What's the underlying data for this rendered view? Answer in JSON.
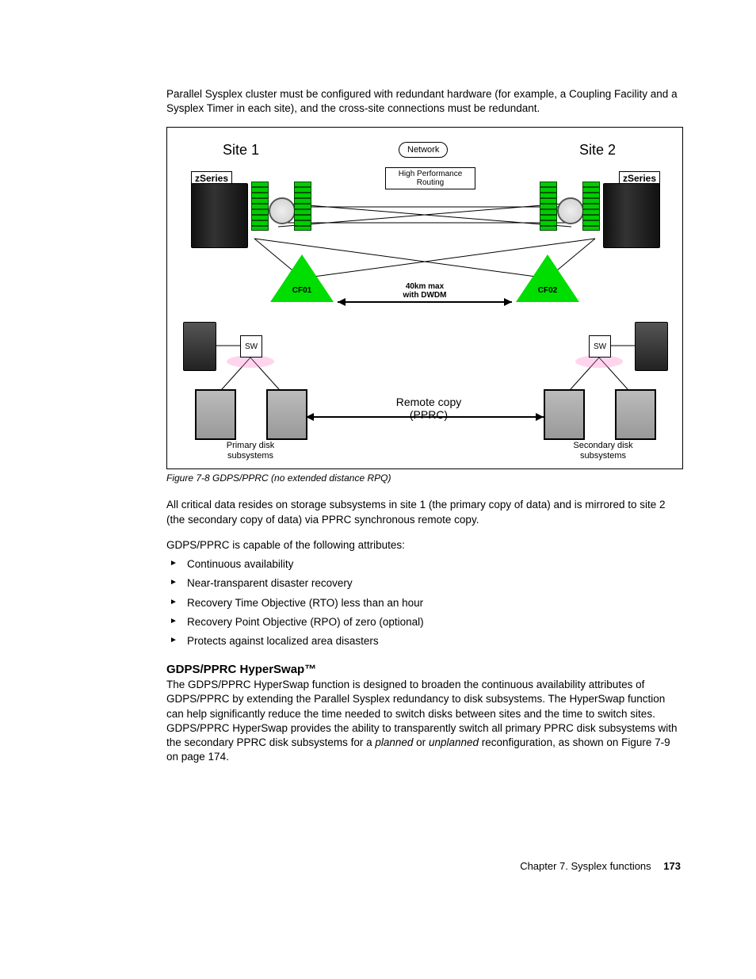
{
  "intro_paragraph": "Parallel Sysplex cluster must be configured with redundant hardware (for example, a Coupling Facility and a Sysplex Timer in each site), and the cross-site connections must be redundant.",
  "figure": {
    "site1": "Site 1",
    "site2": "Site 2",
    "zseries_left": "zSeries",
    "zseries_right": "zSeries",
    "network": "Network",
    "hpr": "High Performance Routing",
    "cf01": "CF01",
    "cf02": "CF02",
    "distance_line1": "40km  max",
    "distance_line2": "with DWDM",
    "sw_left": "SW",
    "sw_right": "SW",
    "remote_copy_line1": "Remote copy",
    "remote_copy_line2": "(PPRC)",
    "primary_disk_line1": "Primary disk",
    "primary_disk_line2": "subsystems",
    "secondary_disk_line1": "Secondary disk",
    "secondary_disk_line2": "subsystems",
    "caption": "Figure 7-8   GDPS/PPRC (no extended distance RPQ)"
  },
  "para_after_figure": "All critical data resides on storage subsystems in site 1 (the primary copy of data) and is mirrored to site 2 (the secondary copy of data) via PPRC synchronous remote copy.",
  "attributes_intro": "GDPS/PPRC is capable of the following attributes:",
  "bullets": [
    "Continuous availability",
    "Near-transparent disaster recovery",
    "Recovery Time Objective (RTO) less than an hour",
    "Recovery Point Objective (RPO) of zero (optional)",
    "Protects against localized area disasters"
  ],
  "hyperswap": {
    "heading": "GDPS/PPRC HyperSwap™",
    "body_pre": "The GDPS/PPRC HyperSwap function is designed to broaden the continuous availability attributes of GDPS/PPRC by extending the Parallel Sysplex redundancy to disk subsystems. The HyperSwap function can help significantly reduce the time needed to switch disks between sites and the time to switch sites. GDPS/PPRC HyperSwap provides the ability to transparently switch all primary PPRC disk subsystems with the secondary PPRC disk subsystems for a ",
    "planned": "planned",
    "mid": " or ",
    "unplanned": "unplanned",
    "body_post": " reconfiguration, as shown on Figure 7-9 on page 174."
  },
  "footer": {
    "chapter": "Chapter 7. Sysplex functions",
    "page": "173"
  }
}
